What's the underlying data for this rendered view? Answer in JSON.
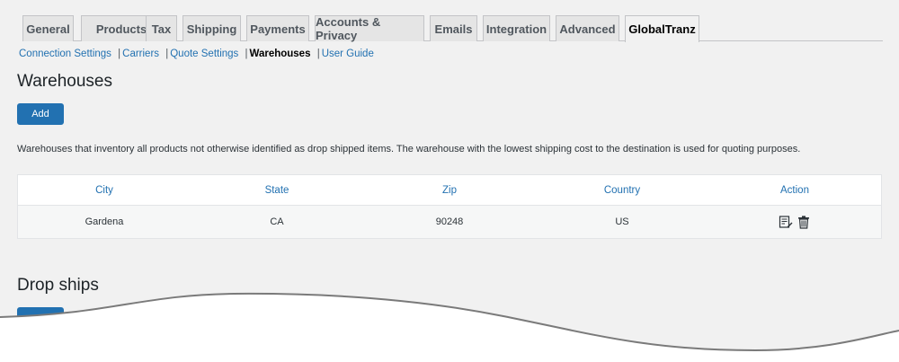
{
  "tabs": [
    {
      "label": "General",
      "active": false
    },
    {
      "label": "Products",
      "active": false
    },
    {
      "label": "Tax",
      "active": false
    },
    {
      "label": "Shipping",
      "active": false
    },
    {
      "label": "Payments",
      "active": false
    },
    {
      "label": "Accounts & Privacy",
      "active": false
    },
    {
      "label": "Emails",
      "active": false
    },
    {
      "label": "Integration",
      "active": false
    },
    {
      "label": "Advanced",
      "active": false
    },
    {
      "label": "GlobalTranz",
      "active": true
    }
  ],
  "subnav": {
    "connection_settings": "Connection Settings",
    "carriers": "Carriers",
    "quote_settings": "Quote Settings",
    "warehouses": "Warehouses",
    "user_guide": "User Guide",
    "separator": "|"
  },
  "warehouses": {
    "title": "Warehouses",
    "add_label": "Add",
    "description": "Warehouses that inventory all products not otherwise identified as drop shipped items. The warehouse with the lowest shipping cost to the destination is used for quoting purposes.",
    "columns": [
      "City",
      "State",
      "Zip",
      "Country",
      "Action"
    ],
    "rows": [
      {
        "city": "Gardena",
        "state": "CA",
        "zip": "90248",
        "country": "US"
      }
    ],
    "action_icons": [
      "edit-icon",
      "trash-icon"
    ]
  },
  "drop_ships": {
    "title": "Drop ships"
  },
  "colors": {
    "accent": "#2271b1",
    "background": "#f1f1f1",
    "tab_bg": "#e5e5e5"
  }
}
